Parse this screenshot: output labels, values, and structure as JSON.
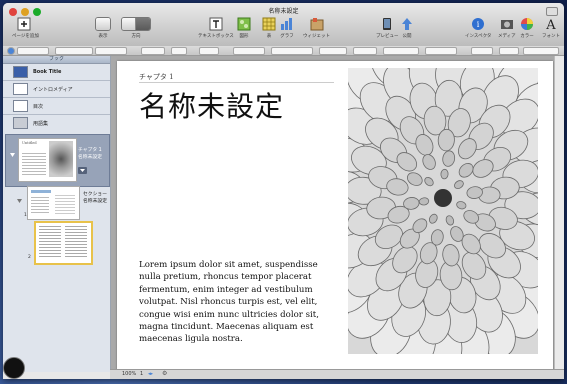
{
  "window": {
    "title": "名称未設定"
  },
  "toolbar": {
    "add_page": "ページを追加",
    "view": "表示",
    "orientation": "方向",
    "textbox": "テキストボックス",
    "shape": "図形",
    "table": "表",
    "chart": "グラフ",
    "widget": "ウィジェット",
    "preview": "プレビュー",
    "publish": "公開",
    "inspector": "インスペクタ",
    "media": "メディア",
    "colors": "カラー",
    "fonts": "フォント"
  },
  "sidebar": {
    "header": "ブック",
    "items": [
      {
        "label": "Book Title"
      },
      {
        "label": "イントロメディア"
      },
      {
        "label": "目次"
      },
      {
        "label": "用語集"
      }
    ],
    "chapter_title": "チャプタ 1",
    "chapter_subtitle": "名称未設定",
    "chapter_thumb_label": "Untitled",
    "section_title": "セクショー",
    "section_subtitle": "名称未設定",
    "page_numbers": [
      "1",
      "2",
      "3"
    ]
  },
  "page": {
    "chapter_label": "チャプタ 1",
    "heading": "名称未設定",
    "body": "Lorem ipsum dolor sit amet, suspendisse nulla pretium, rhoncus tempor placerat fermentum, enim integer ad vestibulum volutpat. Nisl rhoncus turpis est, vel elit, congue wisi enim nunc ultricies dolor sit, magna tincidunt. Maecenas aliquam est maecenas ligula nostra."
  },
  "status": {
    "zoom": "100%",
    "page": "1"
  },
  "colors": {
    "accent": "#4a84d6",
    "selection": "#e8c24a"
  }
}
